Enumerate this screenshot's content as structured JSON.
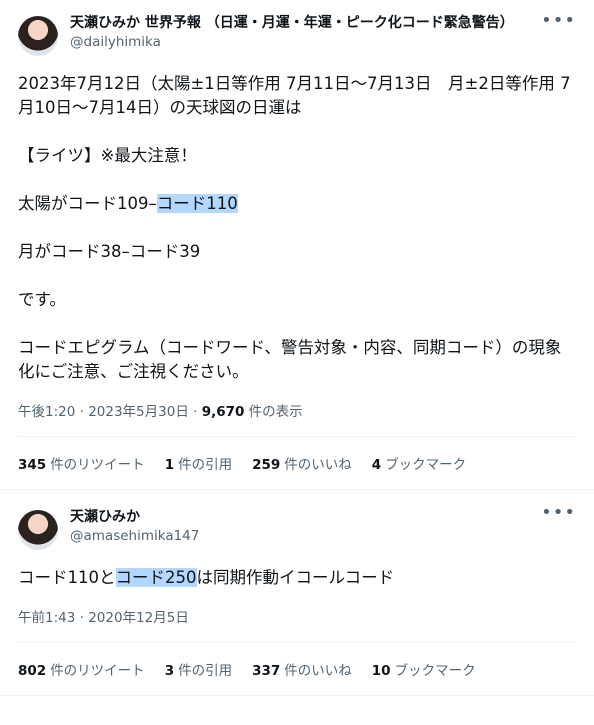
{
  "tweet1": {
    "display_name": "天瀬ひみか 世界予報 （日運・月運・年運・ピーク化コード緊急警告）",
    "handle": "@dailyhimika",
    "line1": "2023年7月12日（太陽±1日等作用 7月11日〜7月13日　月±2日等作用 7月10日〜7月14日）の天球図の日運は",
    "line2": "【ライツ】※最大注意！",
    "line3_prefix": "太陽がコード109–",
    "line3_highlight": "コード110",
    "line4": "月がコード38–コード39",
    "line5": "です。",
    "line6": "コードエピグラム（コードワード、警告対象・内容、同期コード）の現象化にご注意、ご注視ください。",
    "time": "午後1:20 · 2023年5月30日 · ",
    "views_count": "9,670",
    "views_label": " 件の表示",
    "retweets_count": "345",
    "retweets_label": "件のリツイート",
    "quotes_count": "1",
    "quotes_label": "件の引用",
    "likes_count": "259",
    "likes_label": "件のいいね",
    "bookmarks_count": "4",
    "bookmarks_label": "ブックマーク"
  },
  "tweet2": {
    "display_name": "天瀬ひみか",
    "handle": "@amasehimika147",
    "text_prefix": "コード110と",
    "text_highlight": "コード250",
    "text_suffix": "は同期作動イコールコード",
    "time": "午前1:43 · 2020年12月5日",
    "retweets_count": "802",
    "retweets_label": "件のリツイート",
    "quotes_count": "3",
    "quotes_label": "件の引用",
    "likes_count": "337",
    "likes_label": "件のいいね",
    "bookmarks_count": "10",
    "bookmarks_label": "ブックマーク"
  },
  "icons": {
    "more": "more-horizontal-icon"
  },
  "colors": {
    "highlight": "#b3d7ff",
    "secondary_text": "#536471",
    "divider": "#eff3f4"
  }
}
